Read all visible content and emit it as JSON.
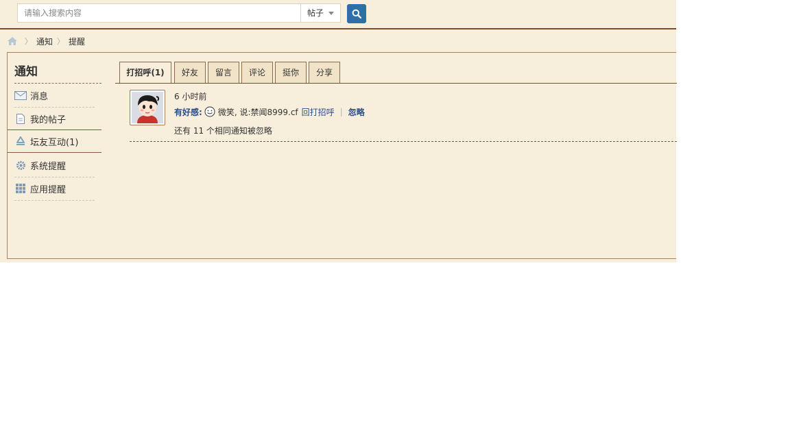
{
  "search": {
    "placeholder": "请输入搜索内容",
    "type_label": "帖子"
  },
  "breadcrumb": [
    "通知",
    "提醒"
  ],
  "sidebar": {
    "title": "通知",
    "items": [
      {
        "label": "消息",
        "icon": "envelope-icon"
      },
      {
        "label": "我的帖子",
        "icon": "document-icon"
      },
      {
        "label": "坛友互动(1)",
        "icon": "recycle-icon",
        "active": true
      },
      {
        "label": "系统提醒",
        "icon": "gear-icon"
      },
      {
        "label": "应用提醒",
        "icon": "grid-icon"
      }
    ]
  },
  "tabs": [
    {
      "label": "打招呼(1)",
      "active": true
    },
    {
      "label": "好友"
    },
    {
      "label": "留言"
    },
    {
      "label": "评论"
    },
    {
      "label": "挺你"
    },
    {
      "label": "分享"
    }
  ],
  "notice": {
    "time": "6 小时前",
    "who": "有好感:",
    "message": "微笑, 说:禁闻8999.cf",
    "reply_link": "回打招呼",
    "ignore_link": "忽略",
    "more_text": "还有 11 个相同通知被忽略"
  },
  "colors": {
    "background": "#f7eedc",
    "border": "#7a4b2a",
    "link": "#2b4e8a",
    "search_button": "#2e6fa8"
  }
}
